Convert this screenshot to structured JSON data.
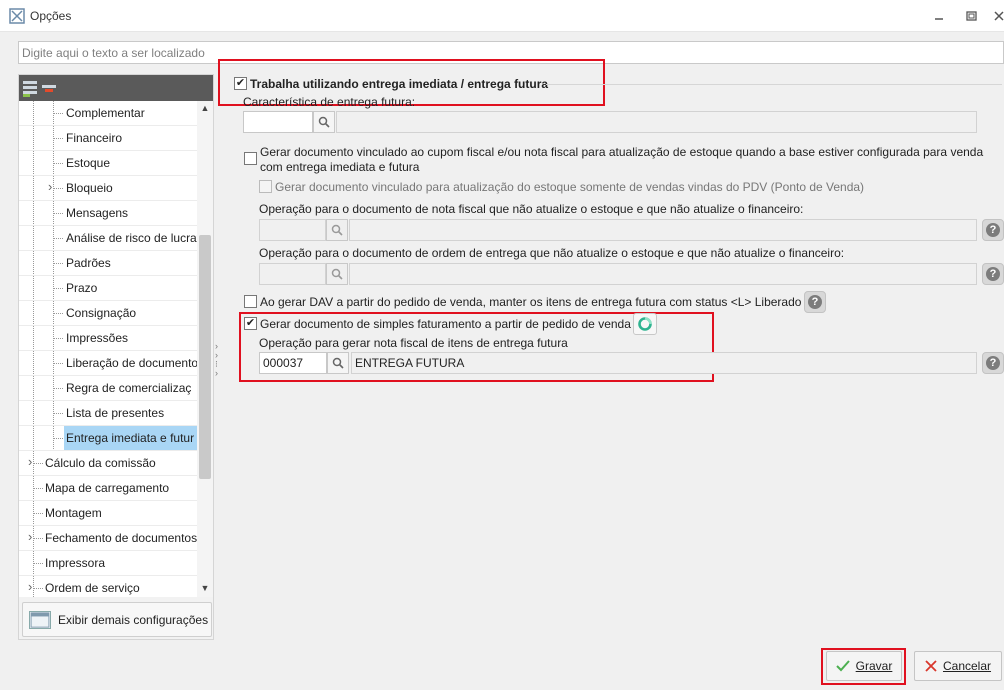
{
  "window": {
    "title": "Opções",
    "icon": "app-logo-icon"
  },
  "search": {
    "placeholder": "Digite aqui o texto a ser localizado"
  },
  "sidebar": {
    "items": [
      {
        "label": "Complementar",
        "level": 2,
        "selected": false
      },
      {
        "label": "Financeiro",
        "level": 2,
        "selected": false
      },
      {
        "label": "Estoque",
        "level": 2,
        "selected": false
      },
      {
        "label": "Bloqueio",
        "level": 2,
        "selected": false
      },
      {
        "label": "Mensagens",
        "level": 2,
        "selected": false
      },
      {
        "label": "Análise de risco de lucrat",
        "level": 2,
        "selected": false
      },
      {
        "label": "Padrões",
        "level": 2,
        "selected": false
      },
      {
        "label": "Prazo",
        "level": 2,
        "selected": false
      },
      {
        "label": "Consignação",
        "level": 2,
        "selected": false
      },
      {
        "label": "Impressões",
        "level": 2,
        "selected": false
      },
      {
        "label": "Liberação de documento",
        "level": 2,
        "selected": false
      },
      {
        "label": "Regra de comercializaç",
        "level": 2,
        "selected": false
      },
      {
        "label": "Lista de presentes",
        "level": 2,
        "selected": false
      },
      {
        "label": "Entrega imediata e futur",
        "level": 2,
        "selected": true
      },
      {
        "label": "Cálculo da comissão",
        "level": 1,
        "selected": false
      },
      {
        "label": "Mapa de carregamento",
        "level": 1,
        "selected": false
      },
      {
        "label": "Montagem",
        "level": 1,
        "selected": false
      },
      {
        "label": "Fechamento de documentos",
        "level": 1,
        "selected": false
      },
      {
        "label": "Impressora",
        "level": 1,
        "selected": false
      },
      {
        "label": "Ordem de serviço",
        "level": 1,
        "selected": false
      }
    ],
    "more_config_label": "Exibir demais configurações"
  },
  "main": {
    "group_title": "Trabalha utilizando entrega imediata / entrega futura",
    "group_checked": true,
    "caracteristica_label": "Característica de entrega futura:",
    "caracteristica_code": "",
    "caracteristica_desc": "",
    "gerar_doc_vinculado_line1": "Gerar documento vinculado ao cupom fiscal e/ou nota fiscal para atualização de estoque quando a base estiver configurada para venda",
    "gerar_doc_vinculado_line2": "com entrega imediata e futura",
    "gerar_doc_vinculado_checked": false,
    "gerar_doc_pdv_label": "Gerar documento vinculado para atualização do estoque somente de vendas vindas do PDV (Ponto de Venda)",
    "gerar_doc_pdv_checked": false,
    "op_nf_label": "Operação para o documento de nota fiscal que não atualize o estoque e que não atualize o financeiro:",
    "op_ordem_label": "Operação para o documento de ordem de entrega que não atualize o estoque e que não atualize o financeiro:",
    "dav_label": "Ao gerar DAV a partir do pedido de venda, manter os itens de entrega futura com status <L> Liberado",
    "dav_checked": false,
    "simples_fat_label": "Gerar documento de simples faturamento a partir de pedido de venda",
    "simples_fat_checked": true,
    "op_simples_label": "Operação para gerar nota fiscal de itens de entrega futura",
    "op_simples_code": "000037",
    "op_simples_desc": "ENTREGA FUTURA",
    "help_glyph": "?"
  },
  "buttons": {
    "save": "Gravar",
    "cancel": "Cancelar"
  },
  "colors": {
    "selection": "#a9d6f5",
    "highlight_box": "#e0101f",
    "save_check": "#4caf50",
    "cancel_x": "#d9362b"
  }
}
